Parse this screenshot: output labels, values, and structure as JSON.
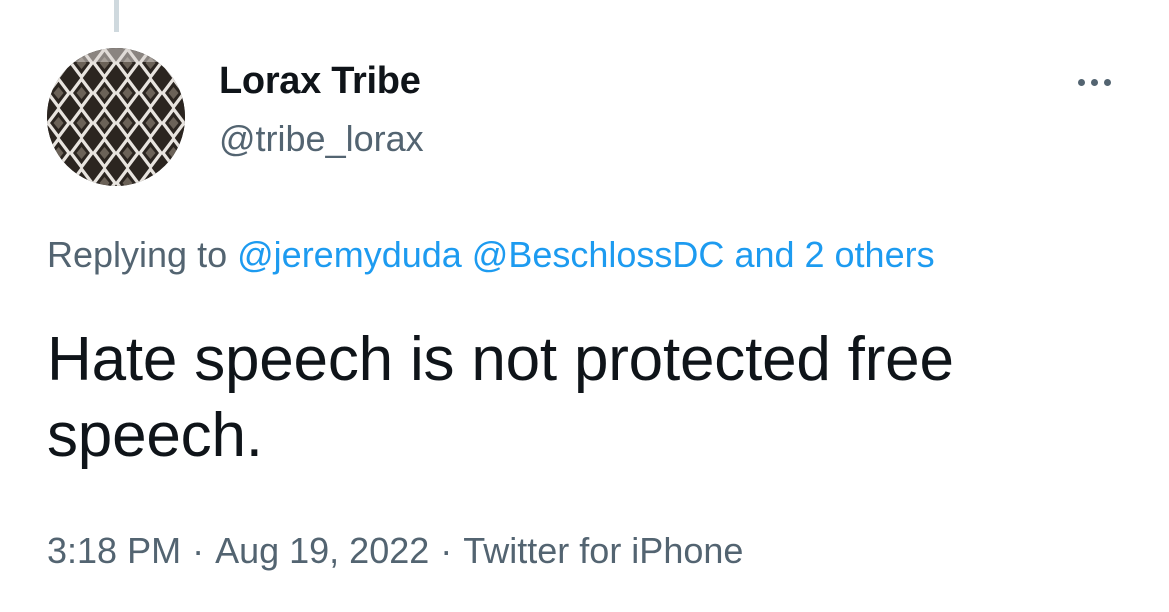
{
  "tweet": {
    "author_name": "Lorax Tribe",
    "author_handle": "@tribe_lorax",
    "avatar_icon": "diamond-lattice-avatar",
    "more_icon": "more-horizontal-icon",
    "replying_prefix": "Replying to",
    "replying_users": [
      "@jeremyduda",
      "@BeschlossDC"
    ],
    "replying_others": "and 2 others",
    "text": "Hate speech is not protected free speech.",
    "time": "3:18 PM",
    "date": "Aug 19, 2022",
    "source": "Twitter for iPhone",
    "separator": "·"
  },
  "colors": {
    "text_primary": "#0f1419",
    "text_secondary": "#536471",
    "link": "#1d9bf0",
    "thread_line": "#cfd9de"
  }
}
